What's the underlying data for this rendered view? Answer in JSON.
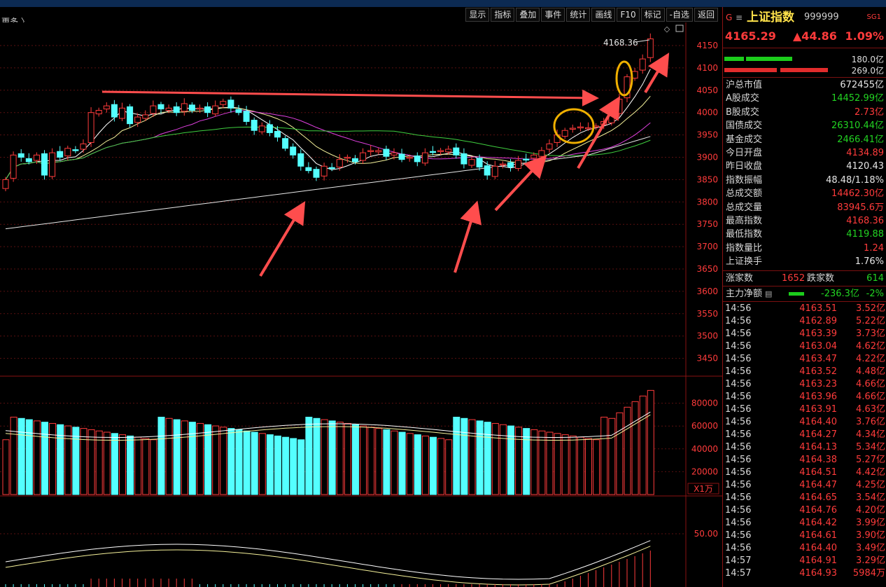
{
  "toolbar": {
    "more_label": "更多 〉",
    "buttons": [
      "显示",
      "指标",
      "叠加",
      "事件",
      "统计",
      "画线",
      "F10",
      "标记",
      "-自选",
      "返回"
    ]
  },
  "price_axis": [
    "4150",
    "4100",
    "4050",
    "4000",
    "3950",
    "3900",
    "3850",
    "3800",
    "3750",
    "3700",
    "3650",
    "3600",
    "3550",
    "3500",
    "3450"
  ],
  "volume_axis": [
    "80000",
    "60000",
    "40000",
    "20000"
  ],
  "volume_unit": "X1万",
  "macd_axis": [
    "50.00"
  ],
  "high_marker": "4168.36",
  "colors": {
    "up": "#ff3b3b",
    "down": "#54ffff",
    "ma5": "#ffffff",
    "ma10": "#f5f19a",
    "ma20": "#e040e0",
    "ma60": "#3fcf3f",
    "annotation": "#ff4d4d",
    "circle": "#f0b000"
  },
  "header": {
    "tag": "G",
    "menu_icon": "menu-icon",
    "name": "上证指数",
    "code": "999999",
    "badge": "SG1",
    "price": "4165.29",
    "change": "▲44.86",
    "change_pct": "1.09%"
  },
  "bars": {
    "top_value": "180.0亿",
    "bottom_value": "269.0亿"
  },
  "stats": [
    {
      "label": "沪总市值",
      "value": "672455亿",
      "color": "white"
    },
    {
      "label": "A股成交",
      "value": "14452.99亿",
      "color": "green"
    },
    {
      "label": "B股成交",
      "value": "2.73亿",
      "color": "red"
    },
    {
      "label": "国债成交",
      "value": "26310.44亿",
      "color": "green"
    },
    {
      "label": "基金成交",
      "value": "2466.41亿",
      "color": "green"
    },
    {
      "label": "今日开盘",
      "value": "4134.89",
      "color": "red"
    },
    {
      "label": "昨日收盘",
      "value": "4120.43",
      "color": "white"
    },
    {
      "label": "指数振幅",
      "value": "48.48/1.18%",
      "color": "white"
    },
    {
      "label": "总成交额",
      "value": "14462.30亿",
      "color": "red"
    },
    {
      "label": "总成交量",
      "value": "83945.6万",
      "color": "red"
    },
    {
      "label": "最高指数",
      "value": "4168.36",
      "color": "red"
    },
    {
      "label": "最低指数",
      "value": "4119.88",
      "color": "green"
    },
    {
      "label": "指数量比",
      "value": "1.24",
      "color": "red"
    },
    {
      "label": "上证换手",
      "value": "1.76%",
      "color": "white"
    }
  ],
  "breadth": {
    "up_label": "涨家数",
    "up_value": "1652",
    "down_label": "跌家数",
    "down_value": "614"
  },
  "main_flow": {
    "label": "主力净额",
    "icon": "list-icon",
    "value": "-236.3亿",
    "pct": "-2%"
  },
  "ticks": [
    {
      "time": "14:56",
      "price": "4163.51",
      "vol": "3.52亿"
    },
    {
      "time": "14:56",
      "price": "4162.89",
      "vol": "5.22亿"
    },
    {
      "time": "14:56",
      "price": "4163.39",
      "vol": "3.73亿"
    },
    {
      "time": "14:56",
      "price": "4163.04",
      "vol": "4.62亿"
    },
    {
      "time": "14:56",
      "price": "4163.47",
      "vol": "4.22亿"
    },
    {
      "time": "14:56",
      "price": "4163.52",
      "vol": "4.48亿"
    },
    {
      "time": "14:56",
      "price": "4163.23",
      "vol": "4.66亿"
    },
    {
      "time": "14:56",
      "price": "4163.96",
      "vol": "4.66亿"
    },
    {
      "time": "14:56",
      "price": "4163.91",
      "vol": "4.63亿"
    },
    {
      "time": "14:56",
      "price": "4164.40",
      "vol": "3.76亿"
    },
    {
      "time": "14:56",
      "price": "4164.27",
      "vol": "4.34亿"
    },
    {
      "time": "14:56",
      "price": "4164.13",
      "vol": "5.34亿"
    },
    {
      "time": "14:56",
      "price": "4164.38",
      "vol": "5.27亿"
    },
    {
      "time": "14:56",
      "price": "4164.51",
      "vol": "4.42亿"
    },
    {
      "time": "14:56",
      "price": "4164.47",
      "vol": "4.25亿"
    },
    {
      "time": "14:56",
      "price": "4164.65",
      "vol": "3.54亿"
    },
    {
      "time": "14:56",
      "price": "4164.76",
      "vol": "4.20亿"
    },
    {
      "time": "14:56",
      "price": "4164.42",
      "vol": "3.99亿"
    },
    {
      "time": "14:56",
      "price": "4164.61",
      "vol": "3.90亿"
    },
    {
      "time": "14:56",
      "price": "4164.40",
      "vol": "3.49亿"
    },
    {
      "time": "14:57",
      "price": "4164.91",
      "vol": "3.29亿"
    },
    {
      "time": "14:57",
      "price": "4164.93",
      "vol": "5984万"
    }
  ]
}
